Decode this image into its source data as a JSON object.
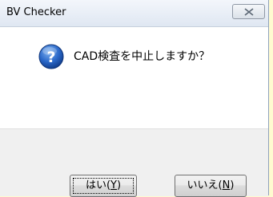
{
  "window": {
    "title": "BV Checker",
    "close_icon": "close-icon"
  },
  "dialog": {
    "icon": "question-icon",
    "message": "CAD検査を中止しますか？"
  },
  "buttons": {
    "yes": {
      "label_prefix": "はい(",
      "accel": "Y",
      "label_suffix": ")"
    },
    "no": {
      "label_prefix": "いいえ(",
      "accel": "N",
      "label_suffix": ")"
    }
  }
}
